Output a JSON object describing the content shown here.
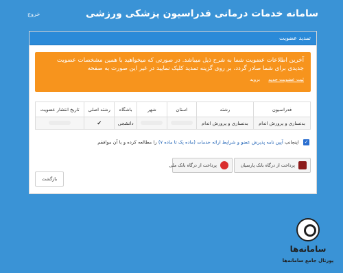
{
  "header": {
    "title": "سامانه خدمات درمانی فدراسیون پزشکی ورزشی",
    "logout_label": "خروج"
  },
  "panel": {
    "title": "تمدید عضویت"
  },
  "alert": {
    "message": "آخرین اطلاعات عضویت شما به شرح ذیل میباشد. در صورتی که میخواهید با همین مشخصات عضویت جدیدی برای شما صادر گردد، بر روی گزینه تمدید کلیک نمایید در غیر این صورت به صفحه",
    "link_label": "ثبت عضویت جدید",
    "back_label": "بروید"
  },
  "table": {
    "headers": [
      "فدراسیون",
      "رشته",
      "استان",
      "شهر",
      "باشگاه",
      "رشته اصلی",
      "تاریخ انتشار عضویت"
    ],
    "rows": [
      {
        "federation": "بدنسازی و پرورش اندام",
        "discipline": "بدنسازی و پرورش اندام",
        "club": "دانشجی"
      }
    ]
  },
  "agreement": {
    "prefix": "اینجانب",
    "link_text": "آیین نامه پذیرش عضو و شرایط ارائه خدمات (ماده یک تا ماده ۷)",
    "suffix": "را مطالعه کرده و با آن موافقم"
  },
  "buttons": {
    "pay_parsian": "پرداخت از درگاه بانک پارسیان",
    "pay_mellat": "پرداخت از درگاه بانک ملی",
    "back": "بازگشت"
  },
  "watermark": {
    "name": "سامانه‌ها",
    "subtitle": "پورتال جامع سامانه‌ها"
  }
}
